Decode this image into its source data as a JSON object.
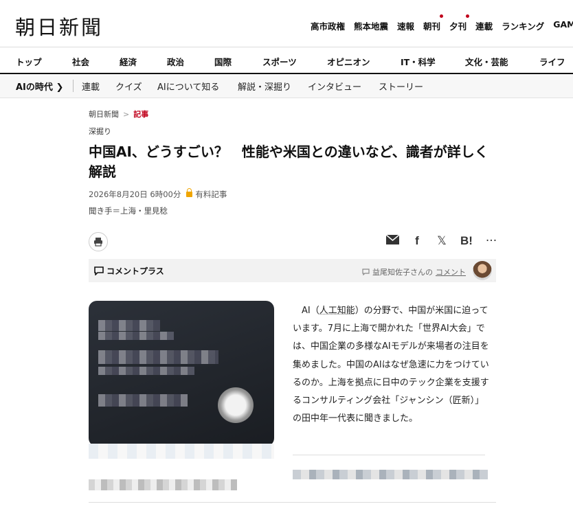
{
  "brand": {
    "logo": "朝日新聞"
  },
  "top_nav": [
    {
      "label": "高市政権",
      "dot": false
    },
    {
      "label": "熊本地震",
      "dot": false
    },
    {
      "label": "速報",
      "dot": false
    },
    {
      "label": "朝刊",
      "dot": true
    },
    {
      "label": "夕刊",
      "dot": true
    },
    {
      "label": "連載",
      "dot": false
    },
    {
      "label": "ランキング",
      "dot": false
    },
    {
      "label": "GAM",
      "dot": false
    }
  ],
  "section_nav": [
    "トップ",
    "社会",
    "経済",
    "政治",
    "国際",
    "スポーツ",
    "オピニオン",
    "IT・科学",
    "文化・芸能",
    "ライフ"
  ],
  "sub_nav": {
    "feature": "AIの時代",
    "items": [
      "連載",
      "クイズ",
      "AIについて知る",
      "解説・深掘り",
      "インタビュー",
      "ストーリー"
    ]
  },
  "breadcrumb": {
    "home": "朝日新聞",
    "current": "記事"
  },
  "article": {
    "label": "深掘り",
    "title": "中国AI、どうすごい？　性能や米国との違いなど、識者が詳しく解説",
    "date": "2026年8月20日 6時00分",
    "paid": "有料記事",
    "byline": "聞き手＝上海・里見稔",
    "lead_pre": "AI（",
    "lead_key": "人工知能",
    "lead_post": "）の分野で、中国が米国に迫っています。7月に上海で開かれた「世界AI大会」では、中国企業の多様なAIモデルが来場者の注目を集めました。中国のAIはなぜ急速に力をつけているのか。上海を拠点に日中のテック企業を支援するコンサルティング会社「ジャンシン（匠新）」の田中年一代表に聞きました。"
  },
  "share": {
    "icons": [
      "mail-icon",
      "facebook-icon",
      "x-icon",
      "hatena-icon",
      "more-icon"
    ],
    "hatena": "B!",
    "more": "···"
  },
  "comment_plus": {
    "label": "コメントプラス",
    "commenter": "益尾知佐子さんの",
    "link": "コメント"
  },
  "colors": {
    "accent": "#c0001b",
    "lock": "#f0a500"
  }
}
